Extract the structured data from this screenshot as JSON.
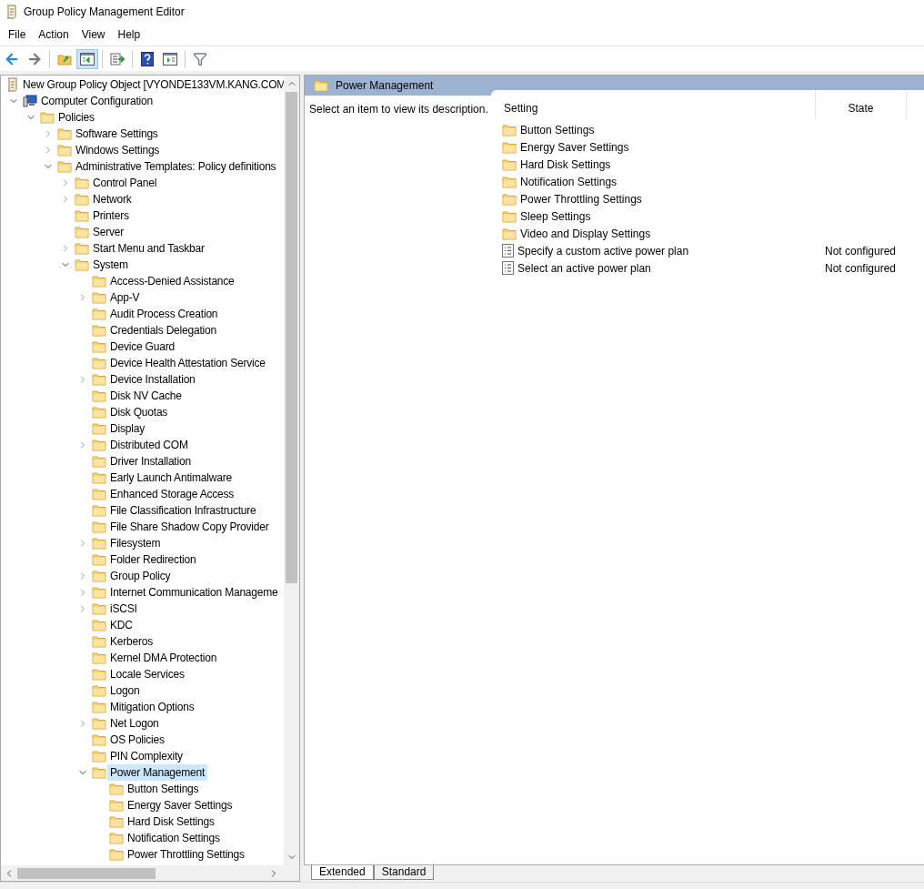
{
  "window": {
    "title": "Group Policy Management Editor"
  },
  "menu": [
    "File",
    "Action",
    "View",
    "Help"
  ],
  "toolbar": [
    {
      "kind": "back",
      "selected": false
    },
    {
      "kind": "forward",
      "selected": false
    },
    {
      "kind": "up",
      "selected": false
    },
    {
      "kind": "tree",
      "selected": true
    },
    {
      "kind": "export",
      "selected": false
    },
    {
      "kind": "help",
      "selected": false
    },
    {
      "kind": "pane",
      "selected": false
    },
    {
      "kind": "filter",
      "selected": false
    }
  ],
  "tree": [
    {
      "label": "New Group Policy Object [VYONDE133VM.KANG.COM",
      "kind": "document",
      "selected": false,
      "children": [
        {
          "label": "Computer Configuration",
          "kind": "computer",
          "selected": false,
          "expanded": true,
          "children": [
            {
              "label": "Policies",
              "kind": "folder",
              "selected": false,
              "expanded": true,
              "children": [
                {
                  "label": "Software Settings",
                  "kind": "folder",
                  "selected": false,
                  "expanded": false
                },
                {
                  "label": "Windows Settings",
                  "kind": "folder",
                  "selected": false,
                  "expanded": false
                },
                {
                  "label": "Administrative Templates: Policy definitions",
                  "kind": "folder",
                  "selected": false,
                  "expanded": true,
                  "children": [
                    {
                      "label": "Control Panel",
                      "kind": "folder",
                      "selected": false,
                      "expanded": false
                    },
                    {
                      "label": "Network",
                      "kind": "folder",
                      "selected": false,
                      "expanded": false
                    },
                    {
                      "label": "Printers",
                      "kind": "folder",
                      "selected": false
                    },
                    {
                      "label": "Server",
                      "kind": "folder",
                      "selected": false
                    },
                    {
                      "label": "Start Menu and Taskbar",
                      "kind": "folder",
                      "selected": false,
                      "expanded": false
                    },
                    {
                      "label": "System",
                      "kind": "folder",
                      "selected": false,
                      "expanded": true,
                      "children": [
                        {
                          "label": "Access-Denied Assistance",
                          "kind": "folder",
                          "selected": false
                        },
                        {
                          "label": "App-V",
                          "kind": "folder",
                          "selected": false,
                          "expanded": false
                        },
                        {
                          "label": "Audit Process Creation",
                          "kind": "folder",
                          "selected": false
                        },
                        {
                          "label": "Credentials Delegation",
                          "kind": "folder",
                          "selected": false
                        },
                        {
                          "label": "Device Guard",
                          "kind": "folder",
                          "selected": false
                        },
                        {
                          "label": "Device Health Attestation Service",
                          "kind": "folder",
                          "selected": false
                        },
                        {
                          "label": "Device Installation",
                          "kind": "folder",
                          "selected": false,
                          "expanded": false
                        },
                        {
                          "label": "Disk NV Cache",
                          "kind": "folder",
                          "selected": false
                        },
                        {
                          "label": "Disk Quotas",
                          "kind": "folder",
                          "selected": false
                        },
                        {
                          "label": "Display",
                          "kind": "folder",
                          "selected": false
                        },
                        {
                          "label": "Distributed COM",
                          "kind": "folder",
                          "selected": false,
                          "expanded": false
                        },
                        {
                          "label": "Driver Installation",
                          "kind": "folder",
                          "selected": false
                        },
                        {
                          "label": "Early Launch Antimalware",
                          "kind": "folder",
                          "selected": false
                        },
                        {
                          "label": "Enhanced Storage Access",
                          "kind": "folder",
                          "selected": false
                        },
                        {
                          "label": "File Classification Infrastructure",
                          "kind": "folder",
                          "selected": false
                        },
                        {
                          "label": "File Share Shadow Copy Provider",
                          "kind": "folder",
                          "selected": false
                        },
                        {
                          "label": "Filesystem",
                          "kind": "folder",
                          "selected": false,
                          "expanded": false
                        },
                        {
                          "label": "Folder Redirection",
                          "kind": "folder",
                          "selected": false
                        },
                        {
                          "label": "Group Policy",
                          "kind": "folder",
                          "selected": false,
                          "expanded": false
                        },
                        {
                          "label": "Internet Communication Manageme",
                          "kind": "folder",
                          "selected": false,
                          "expanded": false
                        },
                        {
                          "label": "iSCSI",
                          "kind": "folder",
                          "selected": false,
                          "expanded": false
                        },
                        {
                          "label": "KDC",
                          "kind": "folder",
                          "selected": false
                        },
                        {
                          "label": "Kerberos",
                          "kind": "folder",
                          "selected": false
                        },
                        {
                          "label": "Kernel DMA Protection",
                          "kind": "folder",
                          "selected": false
                        },
                        {
                          "label": "Locale Services",
                          "kind": "folder",
                          "selected": false
                        },
                        {
                          "label": "Logon",
                          "kind": "folder",
                          "selected": false
                        },
                        {
                          "label": "Mitigation Options",
                          "kind": "folder",
                          "selected": false
                        },
                        {
                          "label": "Net Logon",
                          "kind": "folder",
                          "selected": false,
                          "expanded": false
                        },
                        {
                          "label": "OS Policies",
                          "kind": "folder",
                          "selected": false
                        },
                        {
                          "label": "PIN Complexity",
                          "kind": "folder",
                          "selected": false
                        },
                        {
                          "label": "Power Management",
                          "kind": "folder",
                          "selected": true,
                          "expanded": true,
                          "children": [
                            {
                              "label": "Button Settings",
                              "kind": "folder",
                              "selected": false
                            },
                            {
                              "label": "Energy Saver Settings",
                              "kind": "folder",
                              "selected": false
                            },
                            {
                              "label": "Hard Disk Settings",
                              "kind": "folder",
                              "selected": false
                            },
                            {
                              "label": "Notification Settings",
                              "kind": "folder",
                              "selected": false
                            },
                            {
                              "label": "Power Throttling Settings",
                              "kind": "folder",
                              "selected": false
                            }
                          ]
                        }
                      ]
                    }
                  ]
                }
              ]
            }
          ]
        }
      ]
    }
  ],
  "details": {
    "title": "Power Management",
    "description": "Select an item to view its description.",
    "columns": [
      "Setting",
      "State"
    ],
    "rows": [
      {
        "kind": "folder",
        "setting": "Button Settings"
      },
      {
        "kind": "folder",
        "setting": "Energy Saver Settings"
      },
      {
        "kind": "folder",
        "setting": "Hard Disk Settings"
      },
      {
        "kind": "folder",
        "setting": "Notification Settings"
      },
      {
        "kind": "folder",
        "setting": "Power Throttling Settings"
      },
      {
        "kind": "folder",
        "setting": "Sleep Settings"
      },
      {
        "kind": "folder",
        "setting": "Video and Display Settings"
      },
      {
        "kind": "policy",
        "setting": "Specify a custom active power plan",
        "state": "Not configured"
      },
      {
        "kind": "policy",
        "setting": "Select an active power plan",
        "state": "Not configured"
      }
    ]
  },
  "view_tabs": [
    {
      "label": "Extended",
      "selected": true
    },
    {
      "label": "Standard",
      "selected": false
    }
  ]
}
